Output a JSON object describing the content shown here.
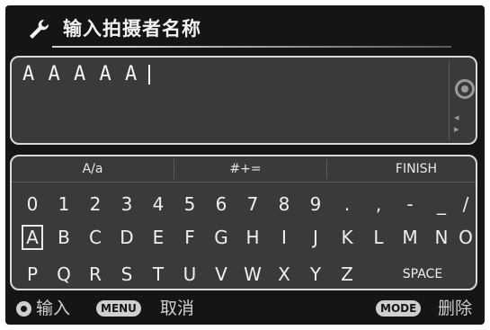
{
  "header": {
    "title": "输入拍摄者名称",
    "icon": "wrench-icon"
  },
  "entry": {
    "value": "A A A A A",
    "side_icon": "dial-icon",
    "arrows": "◂ ▸"
  },
  "keyboard": {
    "functions": {
      "case_toggle": "A/a",
      "symbols_toggle": "#+=",
      "finish": "FINISH"
    },
    "rows": [
      [
        "0",
        "1",
        "2",
        "3",
        "4",
        "5",
        "6",
        "7",
        "8",
        "9",
        ".",
        ",",
        "-",
        "_",
        "/"
      ],
      [
        "A",
        "B",
        "C",
        "D",
        "E",
        "F",
        "G",
        "H",
        "I",
        "J",
        "K",
        "L",
        "M",
        "N",
        "O"
      ],
      [
        "P",
        "Q",
        "R",
        "S",
        "T",
        "U",
        "V",
        "W",
        "X",
        "Y",
        "Z"
      ]
    ],
    "space_label": "SPACE",
    "selected_key": "A"
  },
  "footer": {
    "enter_label": "输入",
    "menu_button": "MENU",
    "cancel_label": "取消",
    "mode_button": "MODE",
    "delete_label": "删除"
  },
  "colors": {
    "background": "#151515",
    "panel": "#3a3a3a",
    "border": "#d9d9d9",
    "text": "#efefef"
  }
}
